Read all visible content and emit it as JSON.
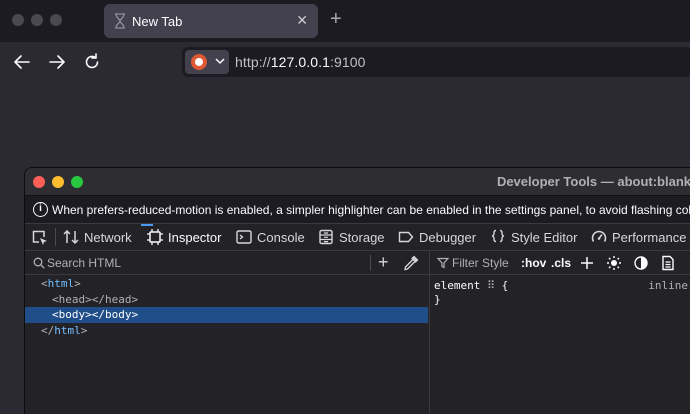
{
  "browser": {
    "tab": {
      "title": "New Tab"
    },
    "url": {
      "host": "127.0.0.1",
      "prefix": "http://",
      "port": ":9100"
    }
  },
  "devtools": {
    "window_title": "Developer Tools — about:blank",
    "notice": "When prefers-reduced-motion is enabled, a simpler highlighter can be enabled in the settings panel, to avoid flashing colors.",
    "tools": [
      {
        "label": "Network",
        "icon": "network-icon"
      },
      {
        "label": "Inspector",
        "icon": "inspector-icon"
      },
      {
        "label": "Console",
        "icon": "console-icon"
      },
      {
        "label": "Storage",
        "icon": "storage-icon"
      },
      {
        "label": "Debugger",
        "icon": "debugger-icon"
      },
      {
        "label": "Style Editor",
        "icon": "style-editor-icon"
      },
      {
        "label": "Performance",
        "icon": "performance-icon"
      }
    ],
    "selected_tool": "Inspector",
    "inspector": {
      "search_placeholder": "Search HTML",
      "markup": {
        "html_open": "html",
        "head": "<head></head>",
        "body": "<body></body>",
        "html_close": "html"
      },
      "rules": {
        "filter_placeholder": "Filter Style",
        "hov_label": ":hov",
        "cls_label": ".cls",
        "selector": "element",
        "open_brace": "{",
        "close_brace": "}",
        "source": "inline"
      }
    }
  },
  "colors": {
    "accent": "#4a9cf0",
    "selection": "#204e8a",
    "tag": "#75bfff",
    "close": "#ff5f57",
    "minimize": "#febc2e",
    "zoom": "#28c840"
  }
}
